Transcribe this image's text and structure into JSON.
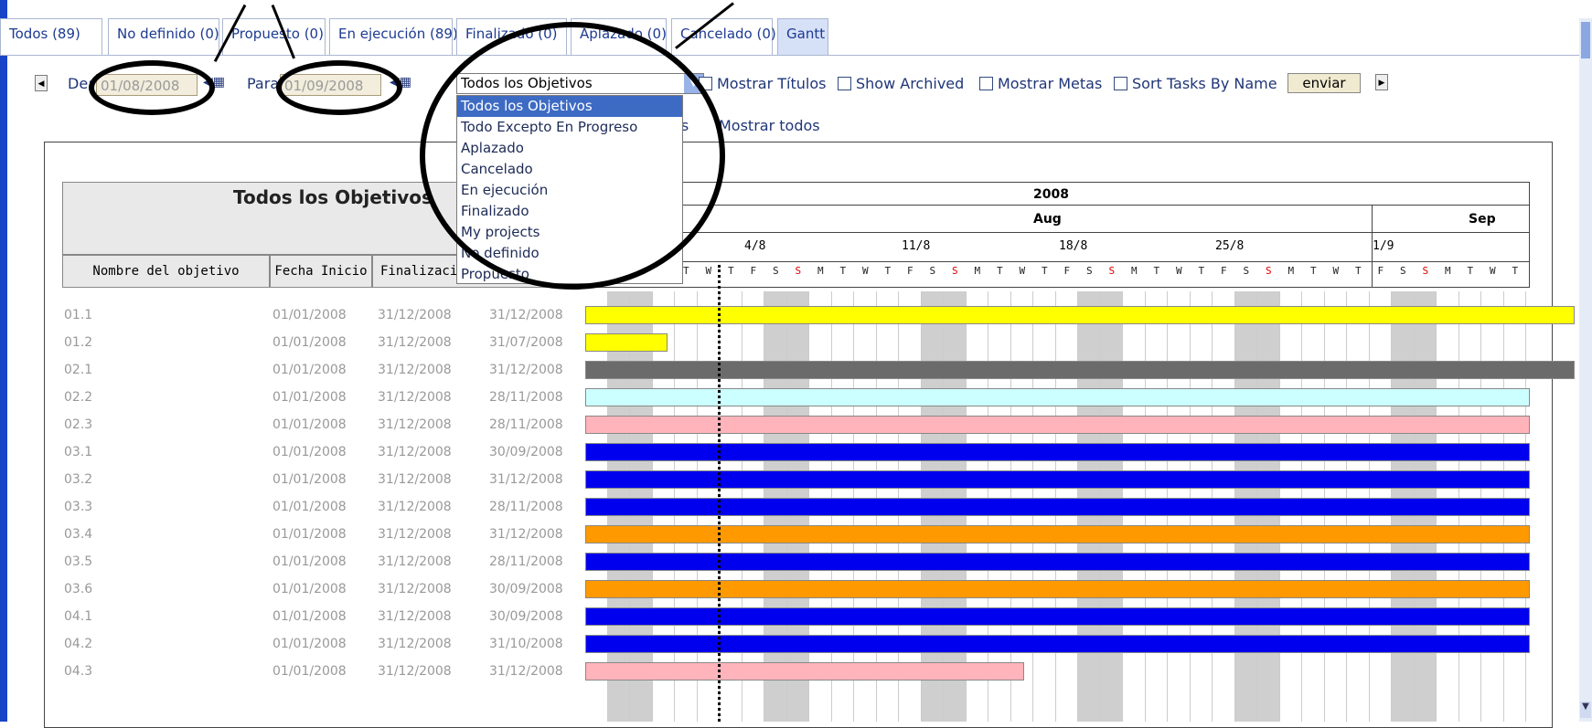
{
  "tabs": [
    {
      "label": "Todos (89)"
    },
    {
      "label": "No definido (0)"
    },
    {
      "label": "Propuesto (0)"
    },
    {
      "label": "En ejecución (89)"
    },
    {
      "label": "Finalizado (0)"
    },
    {
      "label": "Aplazado (0)"
    },
    {
      "label": "Cancelado (0)"
    },
    {
      "label": "Gantt"
    }
  ],
  "filters": {
    "from_label": "De:",
    "from_value": "01/08/2008",
    "to_label": "Para:",
    "to_value": "01/09/2008",
    "select_value": "Todos los Objetivos",
    "options": [
      "Todos los Objetivos",
      "Todo Excepto En Progreso",
      "Aplazado",
      "Cancelado",
      "En ejecución",
      "Finalizado",
      "My projects",
      "No definido",
      "Propuesto"
    ],
    "checks": [
      "Mostrar Títulos",
      "Show Archived",
      "Mostrar Metas",
      "Sort Tasks By Name"
    ],
    "submit": "enviar",
    "links": [
      "es",
      "Mostrar todos"
    ]
  },
  "table": {
    "title": "Todos los Objetivos",
    "columns": [
      "Nombre del objetivo",
      "Fecha Inicio",
      "Finalizaci"
    ],
    "rows": [
      {
        "name": "01.1",
        "start": "01/01/2008",
        "end": "31/12/2008",
        "end2": "31/12/2008"
      },
      {
        "name": "01.2",
        "start": "01/01/2008",
        "end": "31/12/2008",
        "end2": "31/07/2008"
      },
      {
        "name": "02.1",
        "start": "01/01/2008",
        "end": "31/12/2008",
        "end2": "31/12/2008"
      },
      {
        "name": "02.2",
        "start": "01/01/2008",
        "end": "31/12/2008",
        "end2": "28/11/2008"
      },
      {
        "name": "02.3",
        "start": "01/01/2008",
        "end": "31/12/2008",
        "end2": "28/11/2008"
      },
      {
        "name": "03.1",
        "start": "01/01/2008",
        "end": "31/12/2008",
        "end2": "30/09/2008"
      },
      {
        "name": "03.2",
        "start": "01/01/2008",
        "end": "31/12/2008",
        "end2": "31/12/2008"
      },
      {
        "name": "03.3",
        "start": "01/01/2008",
        "end": "31/12/2008",
        "end2": "28/11/2008"
      },
      {
        "name": "03.4",
        "start": "01/01/2008",
        "end": "31/12/2008",
        "end2": "31/12/2008"
      },
      {
        "name": "03.5",
        "start": "01/01/2008",
        "end": "31/12/2008",
        "end2": "28/11/2008"
      },
      {
        "name": "03.6",
        "start": "01/01/2008",
        "end": "31/12/2008",
        "end2": "30/09/2008"
      },
      {
        "name": "04.1",
        "start": "01/01/2008",
        "end": "31/12/2008",
        "end2": "30/09/2008"
      },
      {
        "name": "04.2",
        "start": "01/01/2008",
        "end": "31/12/2008",
        "end2": "31/10/2008"
      },
      {
        "name": "04.3",
        "start": "01/01/2008",
        "end": "31/12/2008",
        "end2": "31/12/2008"
      }
    ]
  },
  "gantt": {
    "year": "2008",
    "months": [
      "Aug",
      "Sep"
    ],
    "weeks": [
      "4/8",
      "11/8",
      "18/8",
      "25/8",
      "1/9"
    ],
    "day_letters": [
      "M",
      "T",
      "W",
      "T",
      "F",
      "S",
      "S"
    ],
    "bar_colors": [
      "#ffff00",
      "#ffff00",
      "#6b6b6b",
      "#ccffff",
      "#ffb3ba",
      "#0000ee",
      "#0000ee",
      "#0000ee",
      "#ff9900",
      "#0000ee",
      "#ff9900",
      "#0000ee",
      "#0000ee",
      "#ffb3ba"
    ]
  }
}
